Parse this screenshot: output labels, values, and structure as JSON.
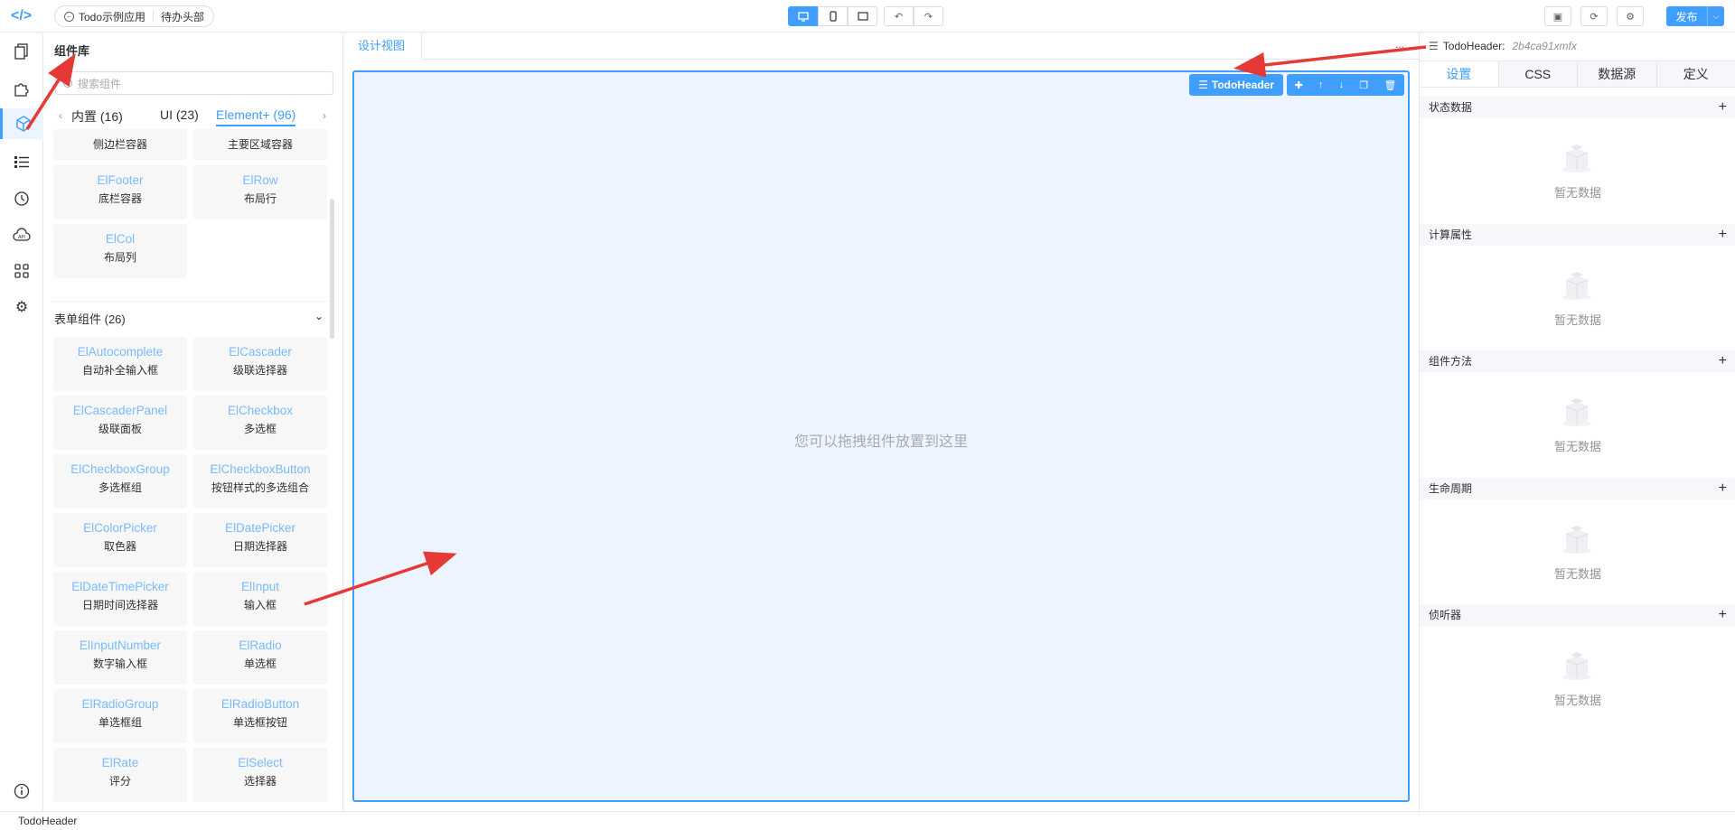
{
  "topbar": {
    "app_name": "Todo示例应用",
    "page_name": "待办头部",
    "publish_label": "发布"
  },
  "library": {
    "title": "组件库",
    "search_placeholder": "搜索组件",
    "tabs": [
      "内置 (16)",
      "UI (23)",
      "Element+ (96)"
    ],
    "layout_cards_top": [
      {
        "zh": "侧边栏容器"
      },
      {
        "zh": "主要区域容器"
      }
    ],
    "layout_cards": [
      {
        "en": "ElFooter",
        "zh": "底栏容器"
      },
      {
        "en": "ElRow",
        "zh": "布局行"
      },
      {
        "en": "ElCol",
        "zh": "布局列"
      }
    ],
    "form_section_title": "表单组件 (26)",
    "form_cards": [
      {
        "en": "ElAutocomplete",
        "zh": "自动补全输入框"
      },
      {
        "en": "ElCascader",
        "zh": "级联选择器"
      },
      {
        "en": "ElCascaderPanel",
        "zh": "级联面板"
      },
      {
        "en": "ElCheckbox",
        "zh": "多选框"
      },
      {
        "en": "ElCheckboxGroup",
        "zh": "多选框组"
      },
      {
        "en": "ElCheckboxButton",
        "zh": "按钮样式的多选组合"
      },
      {
        "en": "ElColorPicker",
        "zh": "取色器"
      },
      {
        "en": "ElDatePicker",
        "zh": "日期选择器"
      },
      {
        "en": "ElDateTimePicker",
        "zh": "日期时间选择器"
      },
      {
        "en": "ElInput",
        "zh": "输入框"
      },
      {
        "en": "ElInputNumber",
        "zh": "数字输入框"
      },
      {
        "en": "ElRadio",
        "zh": "单选框"
      },
      {
        "en": "ElRadioGroup",
        "zh": "单选框组"
      },
      {
        "en": "ElRadioButton",
        "zh": "单选框按钮"
      },
      {
        "en": "ElRate",
        "zh": "评分"
      },
      {
        "en": "ElSelect",
        "zh": "选择器"
      }
    ]
  },
  "design": {
    "tab_label": "设计视图",
    "more": "...",
    "drop_hint": "您可以拖拽组件放置到这里",
    "selected_component": "TodoHeader"
  },
  "panel": {
    "component_name": "TodoHeader:",
    "component_id": "2b4ca91xmfx",
    "tabs": [
      "设置",
      "CSS",
      "数据源",
      "定义"
    ],
    "sections": [
      {
        "title": "状态数据",
        "empty": "暂无数据"
      },
      {
        "title": "计算属性",
        "empty": "暂无数据"
      },
      {
        "title": "组件方法",
        "empty": "暂无数据"
      },
      {
        "title": "生命周期",
        "empty": "暂无数据"
      },
      {
        "title": "侦听器",
        "empty": "暂无数据"
      }
    ]
  },
  "status": {
    "text": "TodoHeader"
  },
  "colors": {
    "accent": "#409eff",
    "arrow": "#e53935"
  }
}
